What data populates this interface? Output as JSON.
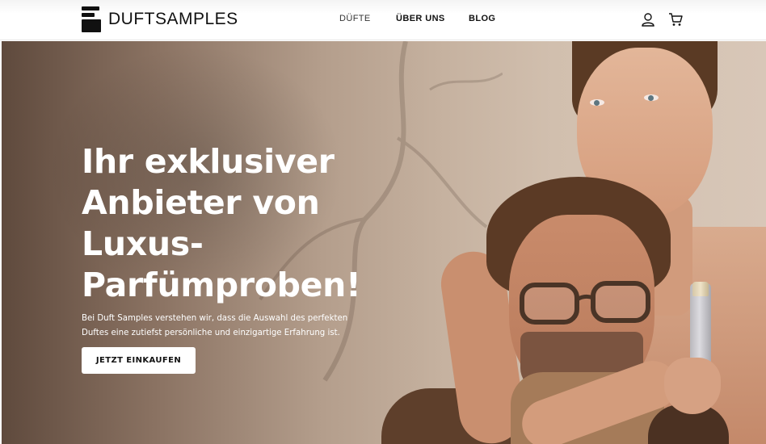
{
  "header": {
    "logo_text": "DUFTSAMPLES",
    "nav": [
      {
        "label": "DÜFTE"
      },
      {
        "label": "ÜBER UNS"
      },
      {
        "label": "BLOG"
      }
    ],
    "icons": [
      "user-icon",
      "cart-icon"
    ]
  },
  "hero": {
    "headline_lines": [
      "Ihr exklusiver",
      "Anbieter von",
      "Luxus-",
      "Parfümproben!"
    ],
    "subtext_lines": [
      "Bei Duft Samples verstehen wir, dass die Auswahl des perfekten",
      "Duftes eine zutiefst persönliche und einzigartige Erfahrung ist."
    ],
    "cta_label": "JETZT EINKAUFEN"
  },
  "colors": {
    "text_light": "#ffffff",
    "text_dark": "#111111",
    "header_bg": "#ffffff"
  }
}
